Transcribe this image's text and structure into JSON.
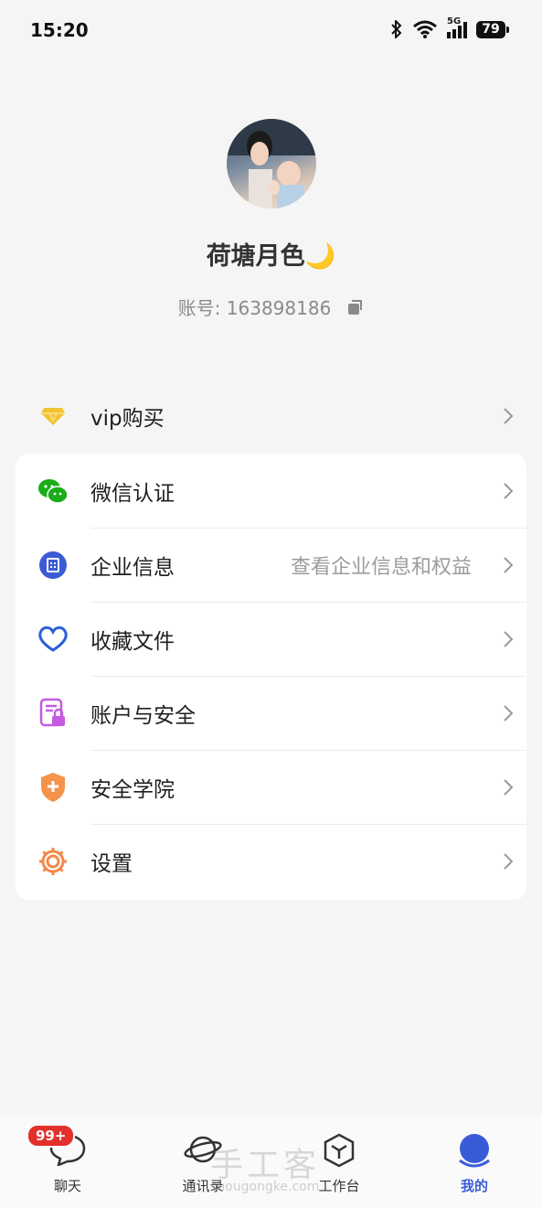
{
  "status_bar": {
    "time": "15:20",
    "network": "5G",
    "battery": "79"
  },
  "profile": {
    "nickname": "荷塘月色🌙",
    "account_label": "账号: 163898186"
  },
  "menu": {
    "vip": {
      "label": "vip购买",
      "icon": "diamond-icon",
      "color": "#f2c232"
    },
    "items": [
      {
        "label": "微信认证",
        "icon": "wechat-icon",
        "color": "#1aad19"
      },
      {
        "label": "企业信息",
        "sub": "查看企业信息和权益",
        "icon": "building-icon",
        "color": "#3b5bd6"
      },
      {
        "label": "收藏文件",
        "icon": "heart-icon",
        "color": "#2c5fd9"
      },
      {
        "label": "账户与安全",
        "icon": "document-lock-icon",
        "color": "#c45be0"
      },
      {
        "label": "安全学院",
        "icon": "shield-icon",
        "color": "#f5934a"
      },
      {
        "label": "设置",
        "icon": "gear-icon",
        "color": "#f08a4b"
      }
    ]
  },
  "tabbar": {
    "tabs": [
      {
        "label": "聊天",
        "badge": "99+",
        "icon": "chat-bubble-icon"
      },
      {
        "label": "通讯录",
        "icon": "planet-icon"
      },
      {
        "label": "工作台",
        "icon": "cube-icon"
      },
      {
        "label": "我的",
        "icon": "profile-circle-icon",
        "active": true
      }
    ],
    "active_color": "#3a5bd9"
  },
  "watermark": {
    "text": "手工客",
    "url": "shougongke.com"
  }
}
